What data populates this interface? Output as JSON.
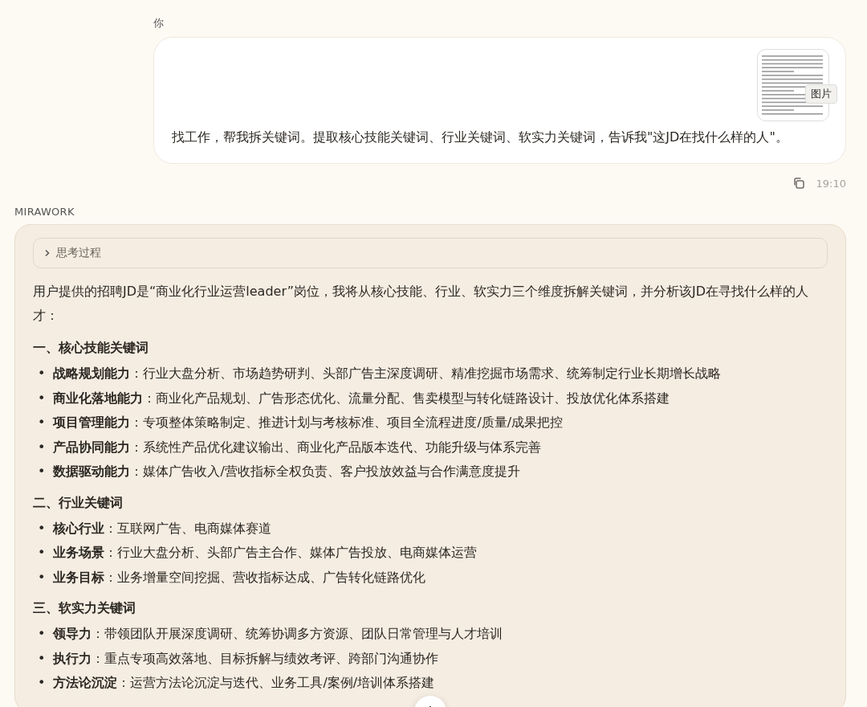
{
  "user_message": {
    "sender": "你",
    "attachment": {
      "kind": "picture",
      "label": "图片"
    },
    "text": "找工作，帮我拆关键词。提取核心技能关键词、行业关键词、软实力关键词，告诉我\"这JD在找什么样的人\"。",
    "time": "19:10"
  },
  "assistant_message": {
    "sender": "MIRAWORK",
    "thinking": {
      "label": "思考过程",
      "expanded": false
    },
    "intro": "用户提供的招聘JD是“商业化行业运营leader”岗位，我将从核心技能、行业、软实力三个维度拆解关键词，并分析该JD在寻找什么样的人才：",
    "sections": [
      {
        "heading": "一、核心技能关键词",
        "items": [
          {
            "marker": "•",
            "term": "战略规划能力",
            "detail": "：行业大盘分析、市场趋势研判、头部广告主深度调研、精准挖掘市场需求、统筹制定行业长期增长战略"
          },
          {
            "marker": "•",
            "term": "商业化落地能力",
            "detail": "：商业化产品规划、广告形态优化、流量分配、售卖模型与转化链路设计、投放优化体系搭建"
          },
          {
            "marker": "•",
            "term": "项目管理能力",
            "detail": "：专项整体策略制定、推进计划与考核标准、项目全流程进度/质量/成果把控"
          },
          {
            "marker": "•",
            "term": "产品协同能力",
            "detail": "：系统性产品优化建议输出、商业化产品版本迭代、功能升级与体系完善"
          },
          {
            "marker": "•",
            "term": "数据驱动能力",
            "detail": "：媒体广告收入/营收指标全权负责、客户投放效益与合作满意度提升"
          }
        ]
      },
      {
        "heading": "二、行业关键词",
        "items": [
          {
            "marker": "•",
            "term": "核心行业",
            "detail": "：互联网广告、电商媒体赛道"
          },
          {
            "marker": "•",
            "term": "业务场景",
            "detail": "：行业大盘分析、头部广告主合作、媒体广告投放、电商媒体运营"
          },
          {
            "marker": "•",
            "term": "业务目标",
            "detail": "：业务增量空间挖掘、营收指标达成、广告转化链路优化"
          }
        ]
      },
      {
        "heading": "三、软实力关键词",
        "items": [
          {
            "marker": "•",
            "term": "领导力",
            "detail": "：带领团队开展深度调研、统筹协调多方资源、团队日常管理与人才培训"
          },
          {
            "marker": "•",
            "term": "执行力",
            "detail": "：重点专项高效落地、目标拆解与绩效考评、跨部门沟通协作"
          },
          {
            "marker": "•",
            "term": "方法论沉淀",
            "detail": "：运营方法论沉淀与迭代、业务工具/案例/培训体系搭建"
          }
        ]
      }
    ]
  }
}
